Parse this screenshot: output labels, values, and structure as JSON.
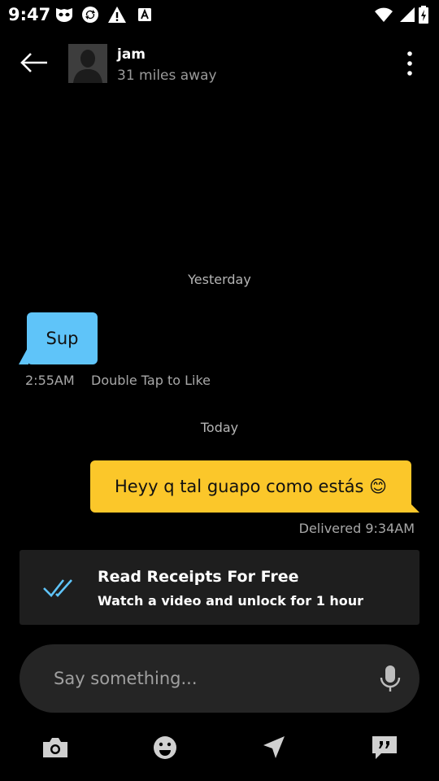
{
  "status_bar": {
    "time": "9:47",
    "icons": [
      "grindr-mask-icon",
      "sync-icon",
      "warning-icon",
      "font-icon",
      "wifi-icon",
      "signal-icon",
      "battery-icon"
    ]
  },
  "header": {
    "contact_name": "jam",
    "distance": "31 miles away",
    "back_icon": "arrow-left-icon",
    "more_icon": "more-vertical-icon"
  },
  "conversation": {
    "dividers": [
      "Yesterday",
      "Today"
    ],
    "messages": [
      {
        "direction": "incoming",
        "text": "Sup",
        "time": "2:55AM",
        "hint": "Double Tap to Like",
        "color": "#5fc4f9"
      },
      {
        "direction": "outgoing",
        "text": "Heyy q tal guapo como estás 😊",
        "status": "Delivered 9:34AM",
        "color": "#fbc72a"
      }
    ]
  },
  "read_receipts_banner": {
    "title": "Read Receipts For Free",
    "subtitle": "Watch a video and unlock for 1 hour",
    "icon": "double-check-icon",
    "icon_color": "#5fc4f9"
  },
  "composer": {
    "placeholder": "Say something...",
    "mic_icon": "microphone-icon"
  },
  "toolbar": {
    "items": [
      "camera-icon",
      "emoji-icon",
      "location-icon",
      "saved-phrases-icon"
    ]
  },
  "colors": {
    "background": "#000000",
    "incoming_bubble": "#5fc4f9",
    "outgoing_bubble": "#fbc72a",
    "banner_bg": "#1e1e1e",
    "composer_bg": "#252525"
  }
}
